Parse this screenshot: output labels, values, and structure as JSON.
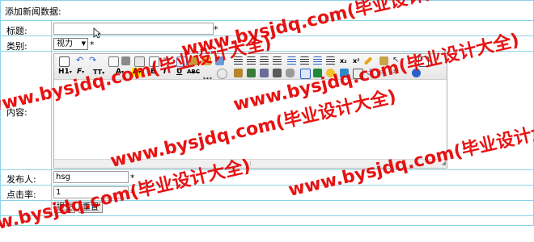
{
  "form": {
    "heading": "添加新闻数据:",
    "title_label": "标题:",
    "title_value": "",
    "category_label": "类别:",
    "category_selected": "视力",
    "content_label": "内容:",
    "publisher_label": "发布人:",
    "publisher_value": "hsg",
    "clicks_label": "点击率:",
    "clicks_value": "1",
    "required_mark": "*",
    "submit_label": "提交",
    "reset_label": "重置"
  },
  "editor": {
    "heading_label": "H1",
    "font_label": "F",
    "size_label": "TT",
    "fontcolor_label": "A",
    "highlight_label": "A",
    "bold_label": "B",
    "italic_label": "I",
    "underline_label": "U",
    "strike_label": "ABC",
    "resize_glyph": "⁞"
  },
  "watermark": {
    "text": "www.bysjdq.com(毕业设计大全)",
    "color": "#e60000"
  },
  "colors": {
    "border": "#8cd3e6"
  }
}
